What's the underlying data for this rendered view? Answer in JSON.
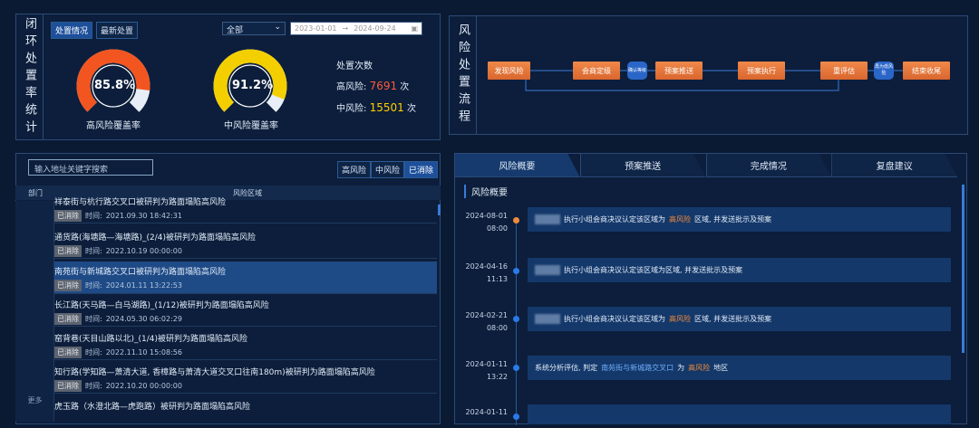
{
  "coverage": {
    "title": "闭环处置率统计",
    "tabs": [
      "处置情况",
      "最新处置"
    ],
    "select_value": "全部",
    "date_start": "2023-01-01",
    "date_end": "2024-09-24",
    "high": {
      "value": "85.8%",
      "label": "高风险覆盖率",
      "pct": 0.858
    },
    "mid": {
      "value": "91.2%",
      "label": "中风险覆盖率",
      "pct": 0.912
    },
    "counts_title": "处置次数",
    "high_count_label": "高风险:",
    "high_count": "7691",
    "mid_count_label": "中风险:",
    "mid_count": "15501",
    "unit": "次"
  },
  "flow": {
    "title": "风险处置流程",
    "steps": [
      "发现风险",
      "会商定级",
      "确认等级",
      "预案推送",
      "预案执行",
      "重评估",
      "再为低风险",
      "结束收尾"
    ]
  },
  "list": {
    "search_placeholder": "输入地址关键字搜索",
    "filters": [
      "高风险",
      "中风险",
      "已消除"
    ],
    "col_dept": "部门",
    "col_area": "风险区域",
    "more": "更多",
    "time_label": "时间:",
    "items": [
      {
        "title": "祥泰街与杭行路交叉口被研判为路面塌陷高风险",
        "status": "已消除",
        "time": "2021.09.30 18:42:31"
      },
      {
        "title": "通货路(海塘路—海塘路)_(2/4)被研判为路面塌陷高风险",
        "status": "已消除",
        "time": "2022.10.19 00:00:00"
      },
      {
        "title": "南苑街与新城路交叉口被研判为路面塌陷高风险",
        "status": "已消除",
        "time": "2024.01.11 13:22:53"
      },
      {
        "title": "长江路(天马路—白马湖路)_(1/12)被研判为路面塌陷高风险",
        "status": "已消除",
        "time": "2024.05.30 06:02:29"
      },
      {
        "title": "窑背巷(天目山路以北)_(1/4)被研判为路面塌陷高风险",
        "status": "已消除",
        "time": "2022.11.10 15:08:56"
      },
      {
        "title": "知行路(学知路—萧清大道, 香樟路与萧清大道交叉口往南180m)被研判为路面塌陷高风险",
        "status": "已消除",
        "time": "2022.10.20 00:00:00"
      },
      {
        "title": "虎玉路（水澄北路—虎跑路）被研判为路面塌陷高风险",
        "status": "",
        "time": ""
      }
    ]
  },
  "detail": {
    "tabs": [
      "风险概要",
      "预案推送",
      "完成情况",
      "复盘建议"
    ],
    "section_title": "风险概要",
    "events": [
      {
        "date": "2024-08-01",
        "time": "08:00",
        "name": "临平区",
        "text1": "执行小组会商决议认定该区域为",
        "level": "高风险",
        "text2": "区域, 并发送批示及预案"
      },
      {
        "date": "2024-04-16",
        "time": "11:13",
        "name": "临平区",
        "text1": "执行小组会商决议认定该区域为区域, 并发送批示及预案",
        "level": "",
        "text2": ""
      },
      {
        "date": "2024-02-21",
        "time": "08:00",
        "name": "临平区",
        "text1": "执行小组会商决议认定该区域为",
        "level": "高风险",
        "text2": "区域, 并发送批示及预案"
      },
      {
        "date": "2024-01-11",
        "time": "13:22",
        "name": "",
        "text1": "系统分析评估, 判定",
        "place": "南苑街与新城路交叉口",
        "mid": "为",
        "level": "高风险",
        "text2": "地区"
      },
      {
        "date": "2024-01-11",
        "time": "",
        "name": "",
        "text1": "",
        "level": "",
        "text2": ""
      }
    ]
  }
}
